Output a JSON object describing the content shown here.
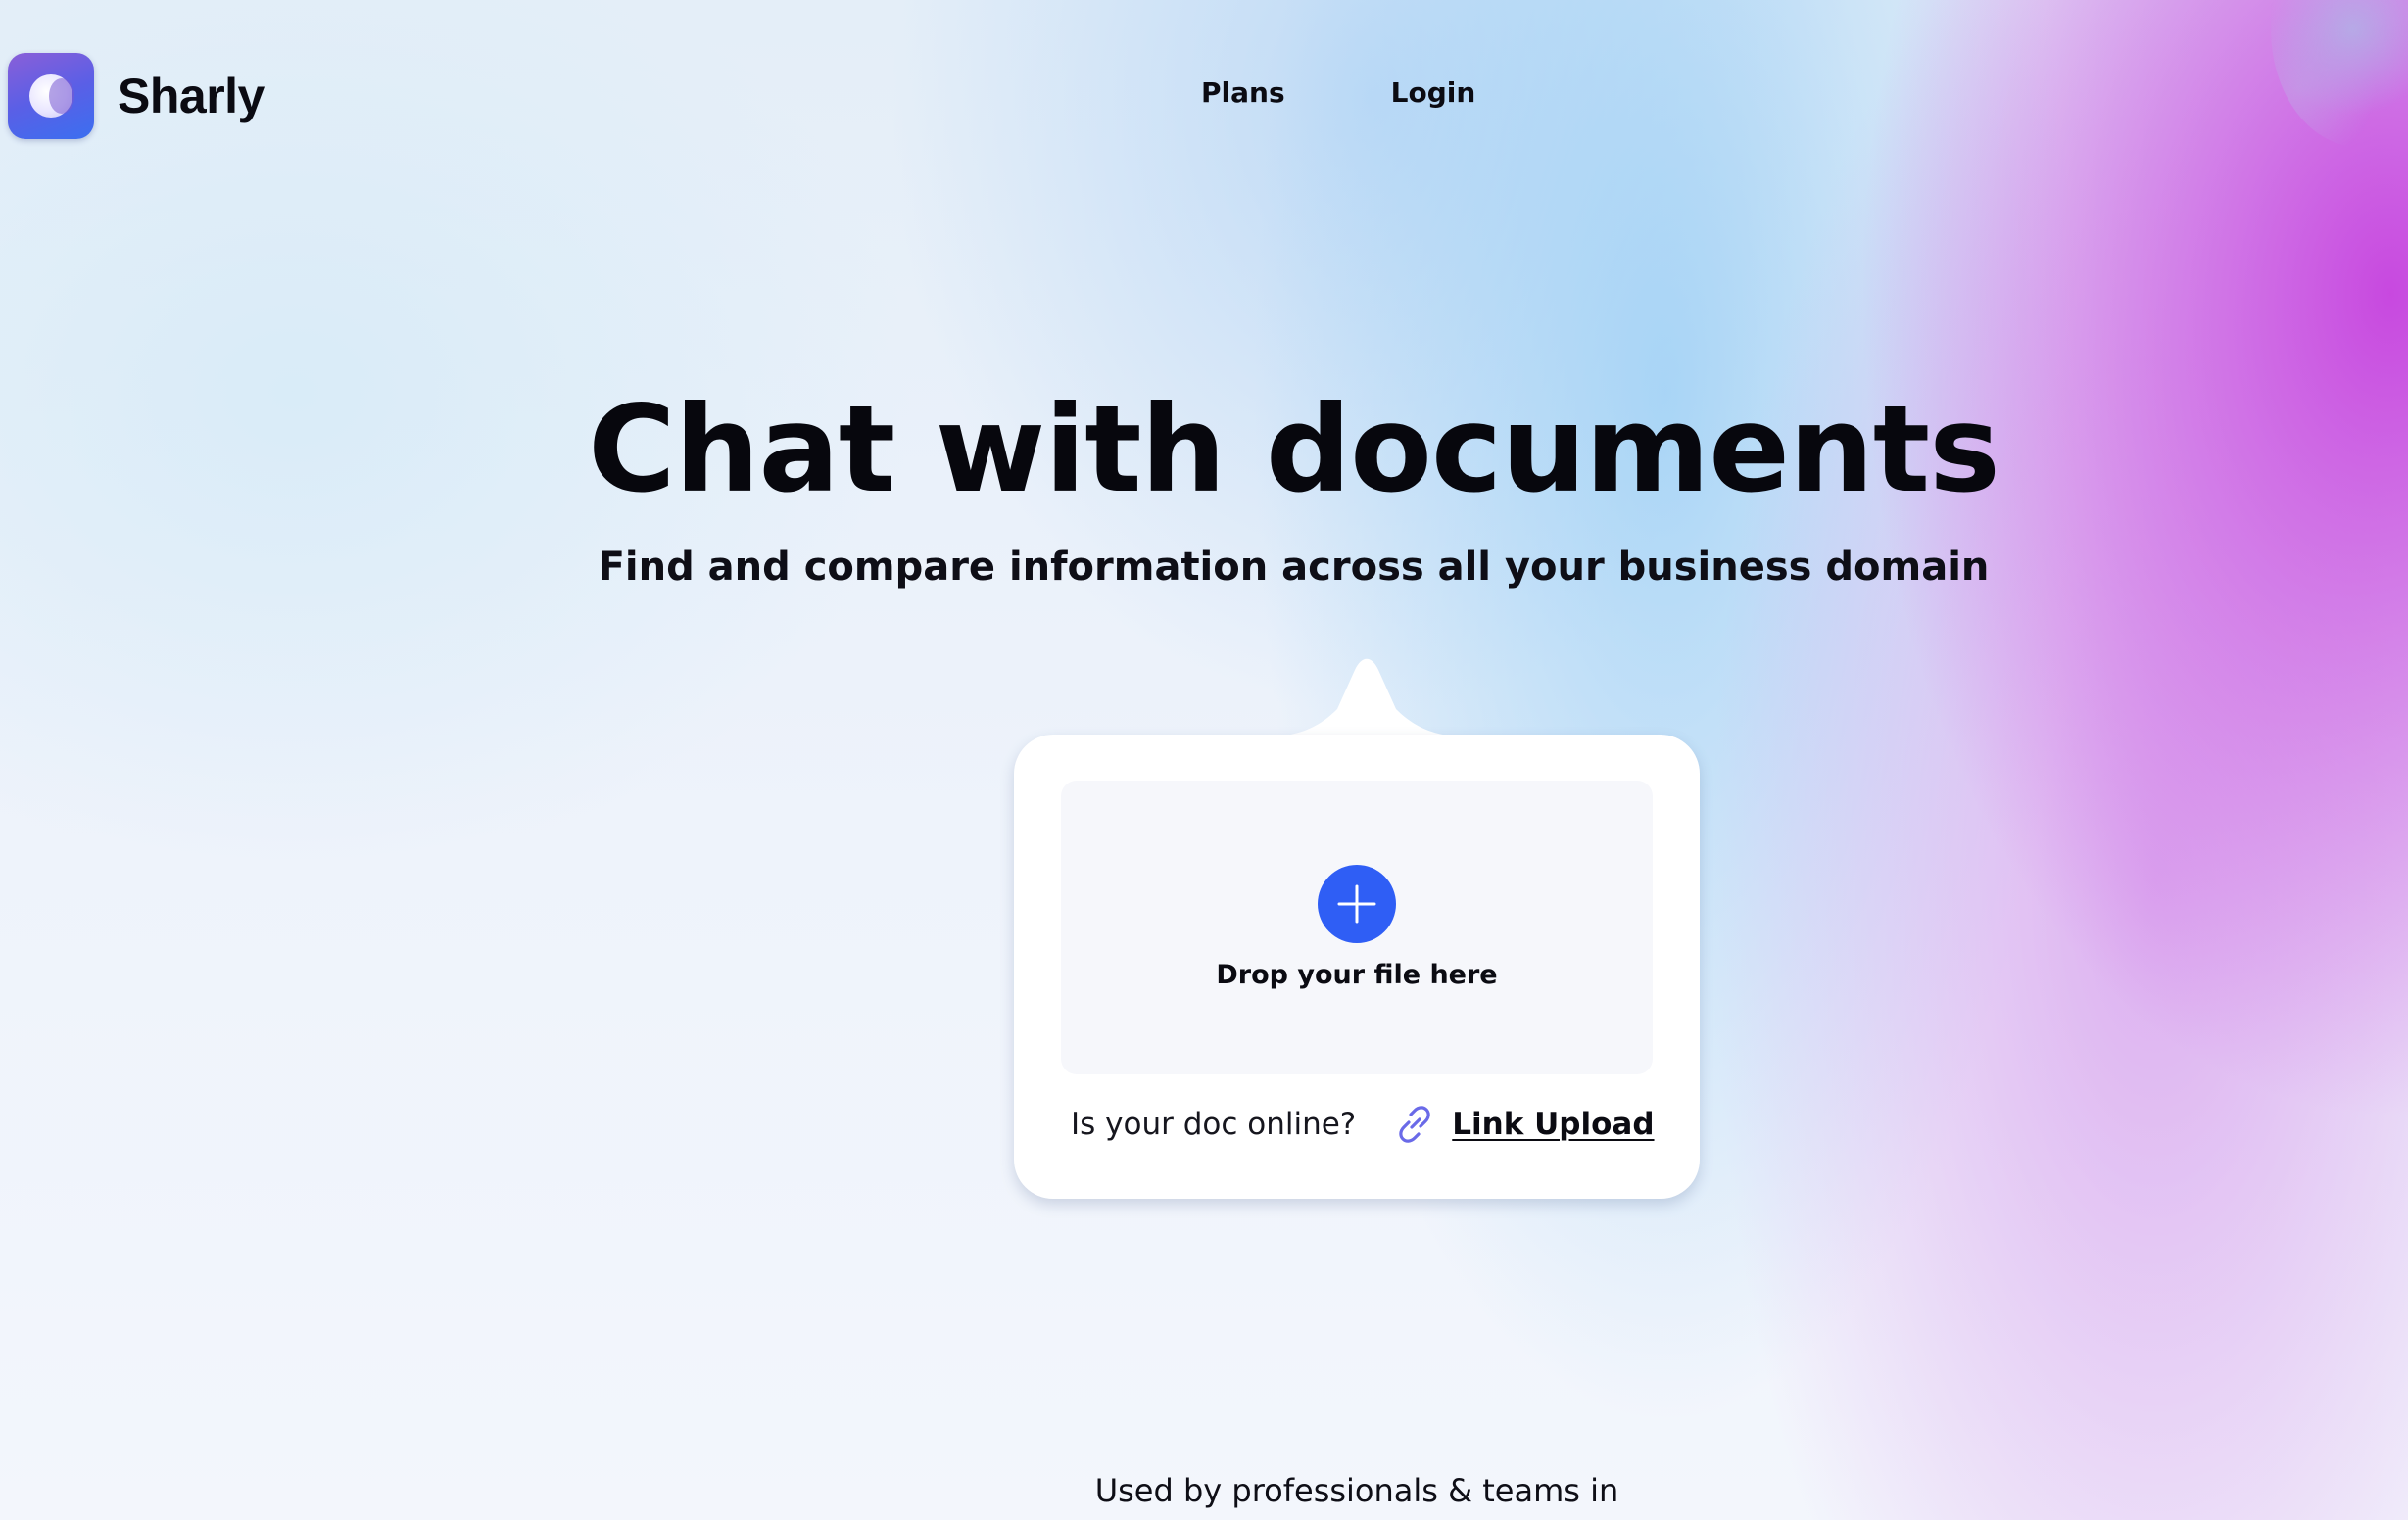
{
  "header": {
    "brand": "Sharly",
    "nav": {
      "plans": "Plans",
      "login": "Login"
    }
  },
  "hero": {
    "title": "Chat with documents",
    "subtitle": "Find and compare information across all your business domain"
  },
  "upload": {
    "drop_label": "Drop your file here",
    "online_question": "Is your doc online?",
    "link_upload": "Link Upload"
  },
  "social_proof": {
    "used_by": "Used by professionals & teams in"
  },
  "icons": {
    "logo": "sharly-logo-icon",
    "add": "plus-icon",
    "link": "link-icon"
  },
  "colors": {
    "accent_blue": "#2f5ef5",
    "link_icon": "#6a6ae8",
    "text": "#0b0b12"
  }
}
